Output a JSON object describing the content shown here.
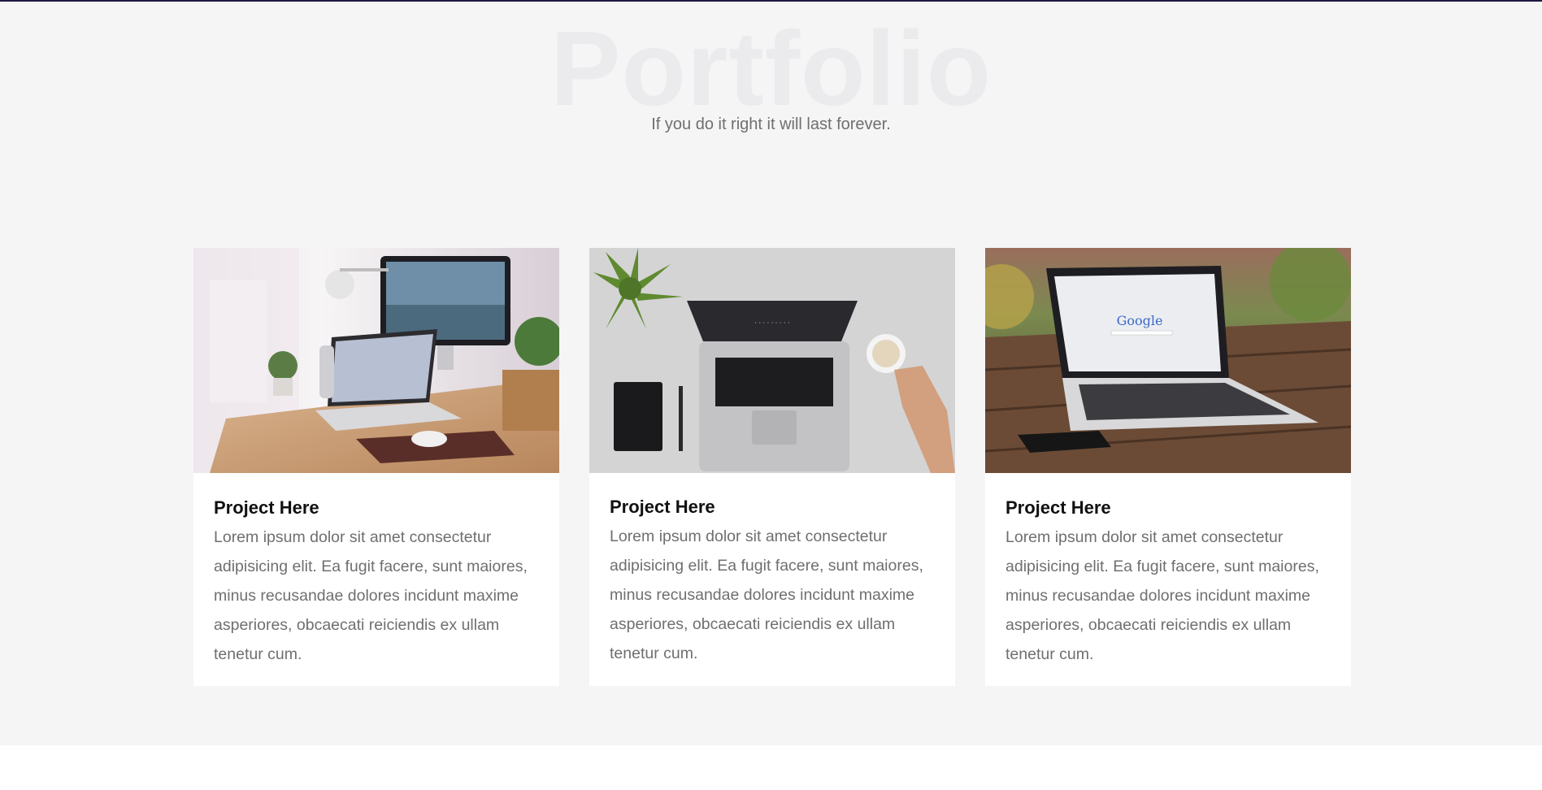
{
  "portfolio": {
    "title": "Portfolio",
    "subtitle": "If you do it right it will last forever."
  },
  "projects": [
    {
      "image": "desk-setup-with-monitor-and-laptop",
      "title": "Project Here",
      "text": "Lorem ipsum dolor sit amet consectetur adipisicing elit. Ea fugit facere, sunt maiores, minus recusandae dolores incidunt maxime asperiores, obcaecati reiciendis ex ullam tenetur cum."
    },
    {
      "image": "laptop-top-view-with-coffee",
      "title": "Project Here",
      "text": "Lorem ipsum dolor sit amet consectetur adipisicing elit. Ea fugit facere, sunt maiores, minus recusandae dolores incidunt maxime asperiores, obcaecati reiciendis ex ullam tenetur cum."
    },
    {
      "image": "laptop-on-wooden-table-google",
      "title": "Project Here",
      "text": "Lorem ipsum dolor sit amet consectetur adipisicing elit. Ea fugit facere, sunt maiores, minus recusandae dolores incidunt maxime asperiores, obcaecati reiciendis ex ullam tenetur cum.",
      "screen_text": "Google"
    }
  ],
  "colors": {
    "top_line": "#1c1a3e",
    "section_bg": "#f5f5f6",
    "watermark_title": "#ebebed",
    "body_text": "#6f6f6f"
  }
}
